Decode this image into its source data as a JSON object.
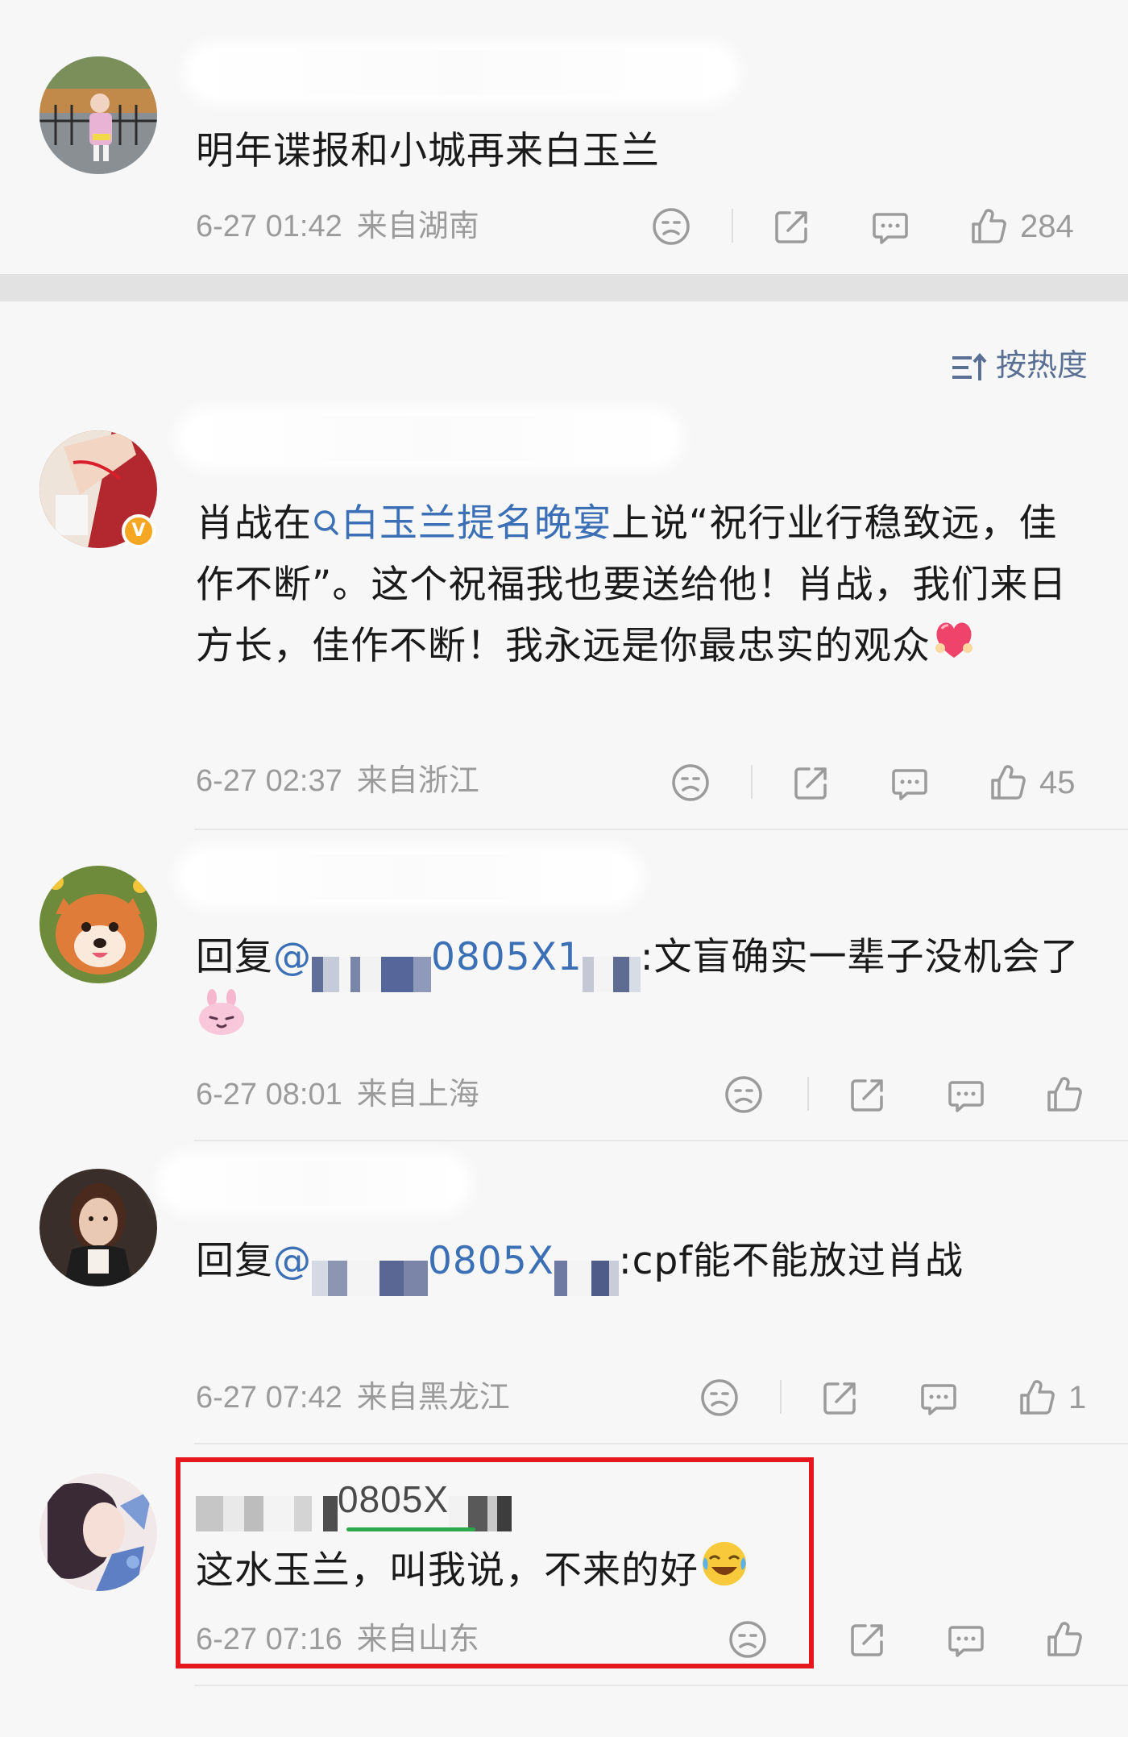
{
  "sort": {
    "label": "按热度",
    "icon": "sort-icon"
  },
  "comments": [
    {
      "text": "明年谍报和小城再来白玉兰",
      "time": "6-27 01:42",
      "location": "来自湖南",
      "likes": "284"
    },
    {
      "text_before": "肖战在",
      "link": "白玉兰提名晚宴",
      "text_after": "上说“祝行业行稳致远，佳作不断”。这个祝福我也要送给他！肖战，我们来日方长，佳作不断！我永远是你最忠实的观众",
      "emoji": "heart-emoji",
      "time": "6-27 02:37",
      "location": "来自浙江",
      "likes": "45",
      "verified": "V"
    },
    {
      "reply_prefix": "回复",
      "mention_at": "@",
      "mention_visible": "0805X1",
      "text": ":文盲确实一辈子没机会了",
      "emoji": "bunny-emoji",
      "time": "6-27 08:01",
      "location": "来自上海",
      "likes": ""
    },
    {
      "reply_prefix": "回复",
      "mention_at": "@",
      "mention_visible": "0805X",
      "text": ":cpf能不能放过肖战",
      "time": "6-27 07:42",
      "location": "来自黑龙江",
      "likes": "1"
    },
    {
      "username_visible": "0805X",
      "text": "这水玉兰，叫我说，不来的好",
      "emoji": "laughing-crying-emoji",
      "time": "6-27 07:16",
      "location": "来自山东",
      "likes": ""
    }
  ],
  "colors": {
    "link": "#3b6fb6",
    "meta": "#9b9b9b",
    "highlight": "#e5161d",
    "underline": "#2aa84a",
    "verified": "#f5a623"
  }
}
